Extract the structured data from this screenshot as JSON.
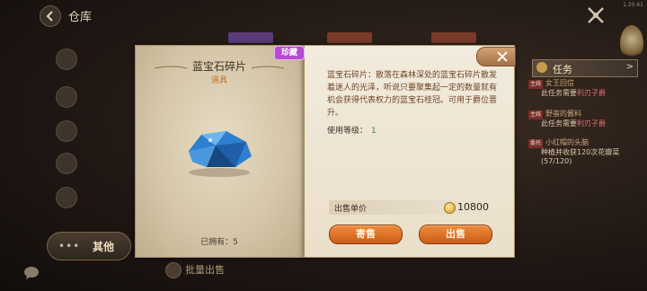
{
  "version": "1.20.61",
  "header": {
    "title": "仓库"
  },
  "sidebar": {
    "other_label": "其他",
    "other_dots": "•••"
  },
  "bottom": {
    "bulk_sell_label": "批量出售"
  },
  "quest_panel": {
    "title": "任务",
    "items": [
      {
        "tag": "主线",
        "title": "女王回信",
        "sub_prefix": "此任务需要",
        "sub_highlight": "利刃子爵"
      },
      {
        "tag": "主线",
        "title": "野蛮的酱料",
        "sub_prefix": "此任务需要",
        "sub_highlight": "利刃子爵"
      },
      {
        "tag": "委托",
        "title": "小红帽的头脑",
        "sub_prefix": "种植并收获120次花瓣菜(57/120)",
        "sub_highlight": ""
      }
    ]
  },
  "item": {
    "name": "蓝宝石碎片",
    "type": "道具",
    "rarity": "珍藏",
    "owned": "已拥有：5",
    "description": "蓝宝石碎片：散落在森林深处的蓝宝石碎片散发着迷人的光泽，听说只要聚集起一定的数量就有机会获得代表权力的蓝宝石桂冠。可用于爵位晋升。",
    "level_label": "使用等级：",
    "level_value": "1",
    "price_label": "出售单价",
    "price_value": "10800",
    "gem_color": "#2f7fd0"
  },
  "buttons": {
    "consign": "寄售",
    "sell": "出售"
  }
}
